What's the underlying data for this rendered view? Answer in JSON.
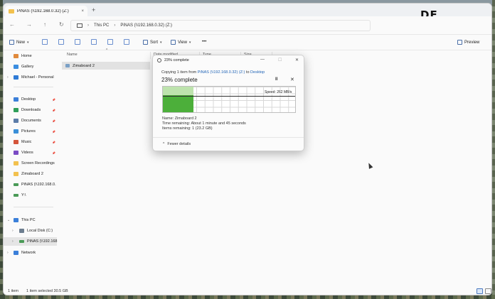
{
  "window": {
    "tab_title": "PiNAS (\\\\192.168.0.32) (Z:)",
    "tab_close": "×",
    "new_tab": "+",
    "logo": "DF"
  },
  "address": {
    "crumbs": [
      "This PC",
      "PiNAS (\\\\192.168.0.32) (Z:)"
    ],
    "separator": "›"
  },
  "nav_buttons": {
    "back": "←",
    "forward": "→",
    "up": "↑",
    "refresh": "↻",
    "more_crumbs": "›"
  },
  "toolbar": {
    "new_label": "New",
    "sort_label": "Sort",
    "view_label": "View",
    "more": "•••",
    "preview_label": "Preview",
    "chevron": "▾"
  },
  "sidebar": {
    "items": [
      {
        "label": "Home",
        "icon": "home-icon",
        "color": "#e08a3c"
      },
      {
        "label": "Gallery",
        "icon": "gallery-icon",
        "color": "#3b8de0"
      },
      {
        "label": "Michael - Personal",
        "icon": "cloud-icon",
        "color": "#2f7bd6"
      },
      {
        "label": "Desktop",
        "icon": "desktop-icon",
        "color": "#3b7fd9"
      },
      {
        "label": "Downloads",
        "icon": "downloads-icon",
        "color": "#2f9e59"
      },
      {
        "label": "Documents",
        "icon": "documents-icon",
        "color": "#5c7ca8"
      },
      {
        "label": "Pictures",
        "icon": "pictures-icon",
        "color": "#3a8fd8"
      },
      {
        "label": "Music",
        "icon": "music-icon",
        "color": "#d4553b"
      },
      {
        "label": "Videos",
        "icon": "videos-icon",
        "color": "#7a4bc4"
      },
      {
        "label": "Screen Recordings",
        "icon": "folder-icon",
        "color": "#f2c14e"
      },
      {
        "label": "Zimaboard 2",
        "icon": "folder-icon",
        "color": "#f2c14e"
      },
      {
        "label": "PiNAS (\\\\192.168.0.",
        "icon": "network-drive-icon",
        "color": "#4a9a57"
      },
      {
        "label": "Y:\\",
        "icon": "network-drive-icon",
        "color": "#4a9a57"
      },
      {
        "label": "This PC",
        "icon": "computer-icon",
        "color": "#3b7fd9"
      },
      {
        "label": "Local Disk (C:)",
        "icon": "disk-icon",
        "color": "#6d7e8f"
      },
      {
        "label": "PiNAS (\\\\192.168.",
        "icon": "network-drive-icon",
        "color": "#4a9a57"
      },
      {
        "label": "Network",
        "icon": "network-icon",
        "color": "#3b7fd9"
      }
    ],
    "pin": "📌",
    "expand": "›",
    "expanded": "⌄"
  },
  "columns": {
    "name": "Name",
    "date": "Date modified",
    "type": "Type",
    "size": "Size",
    "sort_indicator": "^"
  },
  "files": [
    {
      "name": "Zimaboard 2"
    }
  ],
  "status": {
    "count": "1 item",
    "selected": "1 item selected  30.5 GB"
  },
  "dialog": {
    "title": "23% complete",
    "minimize": "—",
    "maximize": "☐",
    "close": "✕",
    "copy_prefix": "Copying 1 item from ",
    "copy_source": "PiNAS (\\\\192.168.0.32) (Z:)",
    "copy_mid": " to ",
    "copy_dest": "Desktop",
    "percent_text": "23% complete",
    "pause": "II",
    "cancel": "✕",
    "speed": "Speed: 262 MB/s",
    "progress": 0.23,
    "name_line": "Name:  Zimaboard 2",
    "time_line": "Time remaining:  About 1 minute and 45 seconds",
    "items_line": "Items remaining:  1 (23.2 GB)",
    "fewer": "Fewer details",
    "fewer_chev": "^"
  }
}
